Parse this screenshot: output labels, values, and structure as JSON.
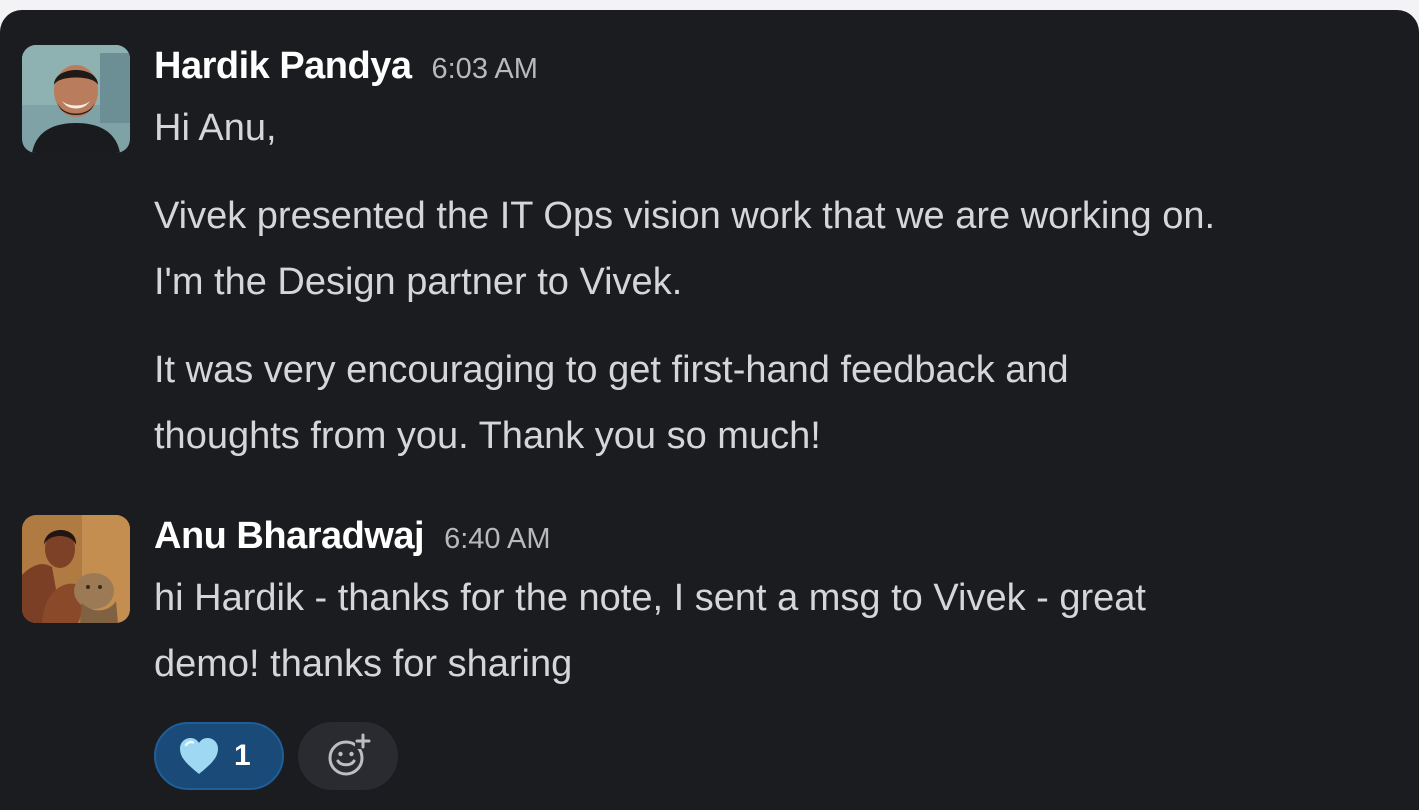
{
  "messages": [
    {
      "author": "Hardik Pandya",
      "time": "6:03 AM",
      "paragraphs": [
        [
          "Hi Anu,"
        ],
        [
          "Vivek presented the IT Ops vision work that we are working on.",
          "I'm the Design partner to Vivek."
        ],
        [
          "It was very encouraging to get first-hand feedback and",
          "thoughts from you. Thank you so much!"
        ]
      ],
      "avatar_icon": "person-photo-avatar"
    },
    {
      "author": "Anu Bharadwaj",
      "time": "6:40 AM",
      "paragraphs": [
        [
          "hi Hardik - thanks for the note, I sent a msg to Vivek - great",
          "demo! thanks for sharing"
        ]
      ],
      "avatar_icon": "person-photo-avatar",
      "reactions": [
        {
          "icon": "light-blue-heart-icon",
          "count": "1",
          "selected": true
        }
      ],
      "add_reaction_icon": "add-emoji-icon"
    }
  ],
  "colors": {
    "background": "#1b1c20",
    "author": "#ffffff",
    "text": "#d5d6d8",
    "time": "#b8b9bc",
    "reaction_selected_bg": "#1a4a78",
    "heart": "#9fd8f3"
  }
}
